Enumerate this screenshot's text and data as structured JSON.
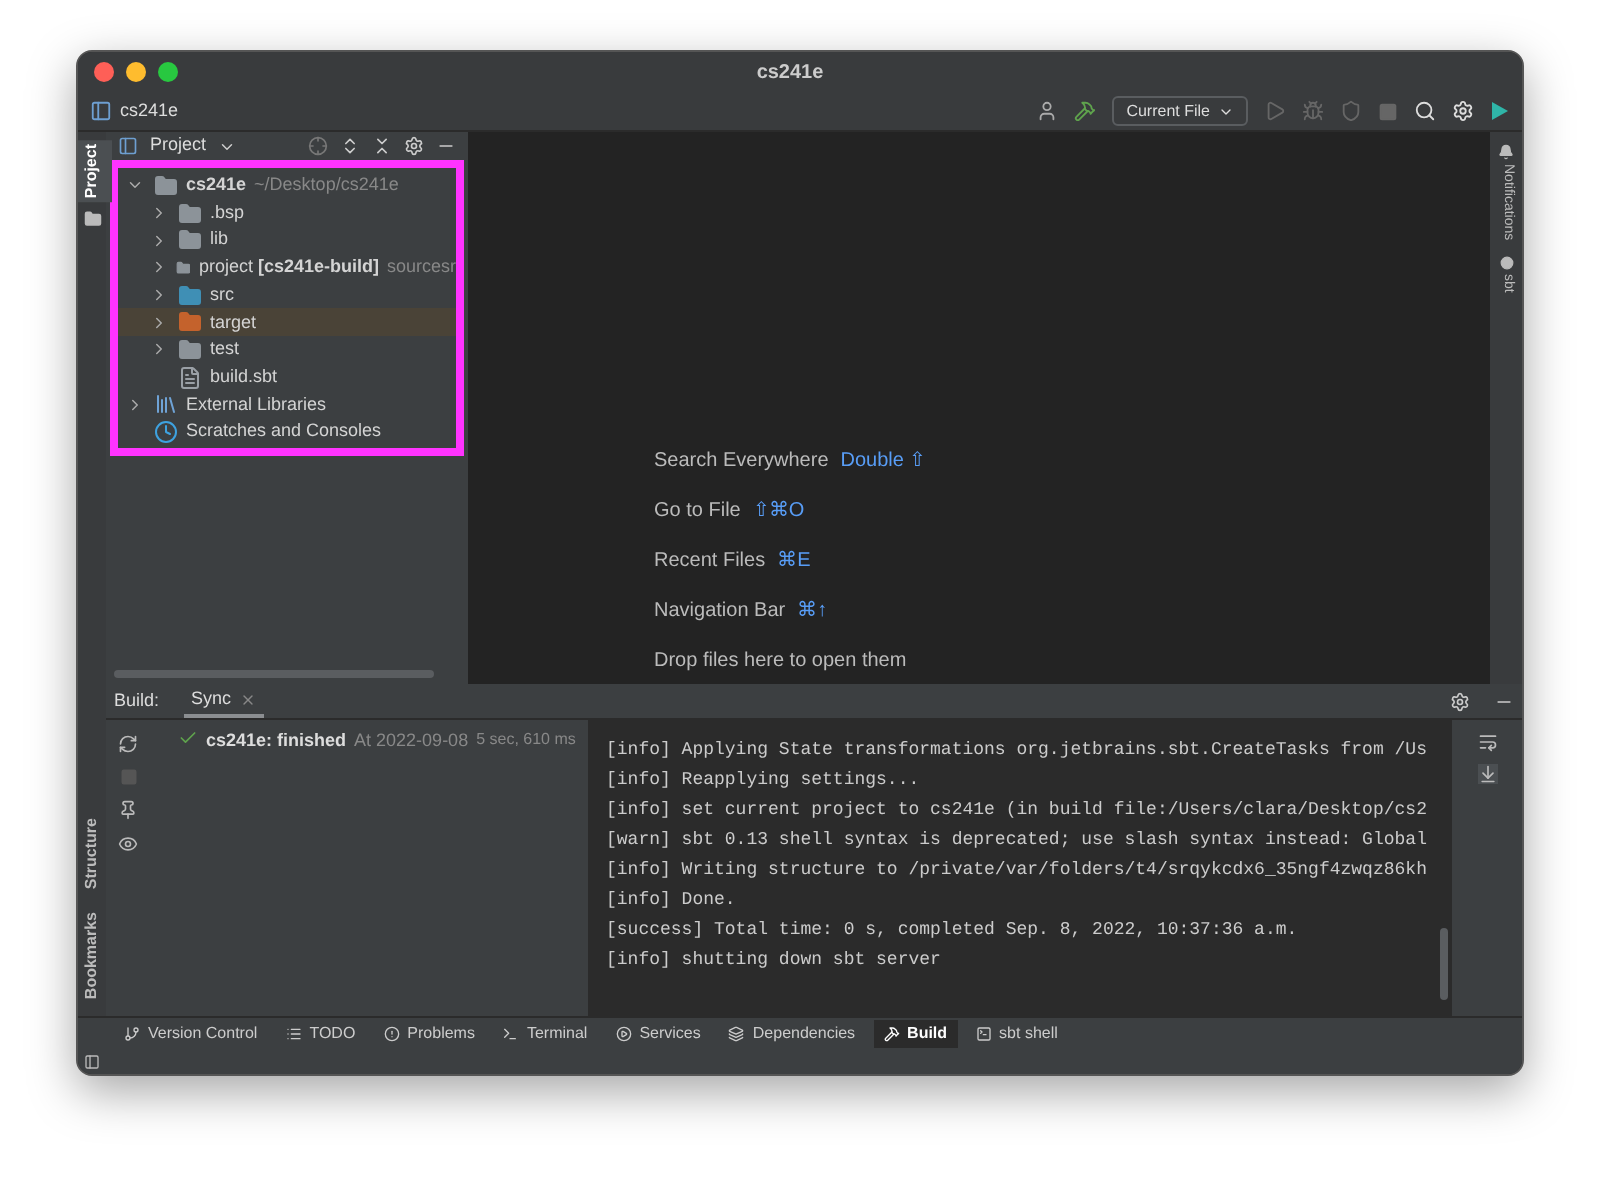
{
  "window": {
    "title": "cs241e"
  },
  "toolbar": {
    "project_name": "cs241e",
    "run_config": "Current File"
  },
  "left_stripe": {
    "top": [
      {
        "label": "Project",
        "selected": true
      }
    ],
    "bottom": [
      {
        "label": "Structure",
        "selected": false
      },
      {
        "label": "Bookmarks",
        "selected": false
      }
    ]
  },
  "right_stripe": [
    {
      "label": "Notifications",
      "kind": "bell"
    },
    {
      "label": "sbt",
      "kind": "dot"
    }
  ],
  "project_panel": {
    "title": "Project",
    "tree": [
      {
        "label": "cs241e",
        "path": "~/Desktop/cs241e",
        "kind": "module",
        "expanded": true,
        "selected": false,
        "children": [
          {
            "label": ".bsp",
            "kind": "folder",
            "expanded": false,
            "selected": false
          },
          {
            "label": "lib",
            "kind": "folder",
            "expanded": false,
            "selected": false
          },
          {
            "label": "project **[cs241e-build]**",
            "suffix": "sourcesr",
            "kind": "module-folder",
            "expanded": false,
            "selected": false
          },
          {
            "label": "src",
            "kind": "source-folder",
            "expanded": false,
            "selected": false
          },
          {
            "label": "target",
            "kind": "excluded-folder",
            "expanded": false,
            "selected": true
          },
          {
            "label": "test",
            "kind": "folder",
            "expanded": false,
            "selected": false
          },
          {
            "label": "build.sbt",
            "kind": "sbt-file",
            "selected": false
          }
        ]
      },
      {
        "label": "External Libraries",
        "kind": "libraries",
        "expanded": false,
        "selected": false
      },
      {
        "label": "Scratches and Consoles",
        "kind": "scratches",
        "selected": false
      }
    ]
  },
  "editor_hints": [
    {
      "label": "Search Everywhere",
      "shortcut": "Double ⇧"
    },
    {
      "label": "Go to File",
      "shortcut": "⇧⌘O"
    },
    {
      "label": "Recent Files",
      "shortcut": "⌘E"
    },
    {
      "label": "Navigation Bar",
      "shortcut": "⌘↑"
    },
    {
      "label": "Drop files here to open them"
    }
  ],
  "build_panel": {
    "label": "Build:",
    "tabs": [
      {
        "label": "Sync",
        "selected": true
      }
    ],
    "sync_item": {
      "name": "cs241e: finished",
      "time": "At 2022-09-08",
      "duration": "5 sec, 610 ms"
    },
    "console": [
      "[info] Applying State transformations org.jetbrains.sbt.CreateTasks from /Us",
      "[info] Reapplying settings...",
      "[info] set current project to cs241e (in build file:/Users/clara/Desktop/cs2",
      "[warn] sbt 0.13 shell syntax is deprecated; use slash syntax instead: Global",
      "[info] Writing structure to /private/var/folders/t4/srqykcdx6_35ngf4zwqz86kh",
      "[info] Done.",
      "[success] Total time: 0 s, completed Sep. 8, 2022, 10:37:36 a.m.",
      "[info] shutting down sbt server"
    ]
  },
  "tool_windows": [
    {
      "label": "Version Control",
      "kind": "branch",
      "selected": false
    },
    {
      "label": "TODO",
      "kind": "list",
      "selected": false
    },
    {
      "label": "Problems",
      "kind": "problems",
      "selected": false
    },
    {
      "label": "Terminal",
      "kind": "terminal",
      "selected": false
    },
    {
      "label": "Services",
      "kind": "services",
      "selected": false
    },
    {
      "label": "Dependencies",
      "kind": "layers",
      "selected": false
    },
    {
      "label": "Build",
      "kind": "hammer",
      "selected": true
    },
    {
      "label": "sbt shell",
      "kind": "shell",
      "selected": false
    }
  ]
}
